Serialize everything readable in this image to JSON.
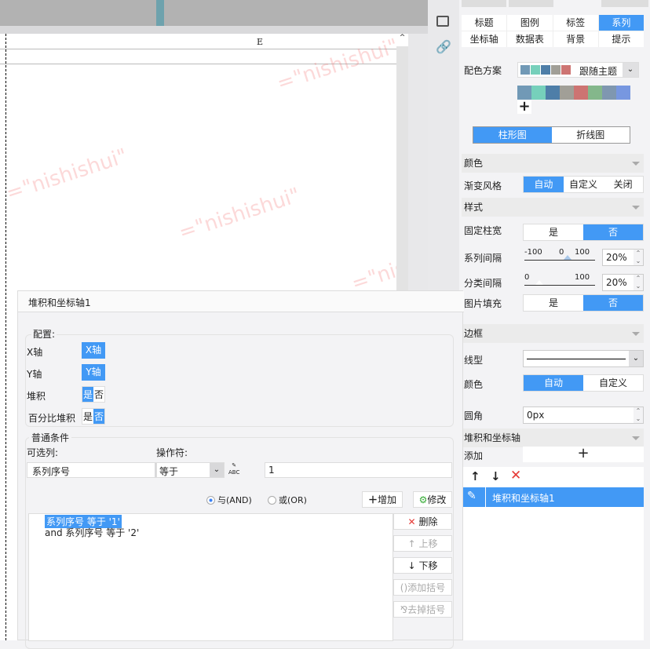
{
  "canvas": {
    "column_header": "E",
    "watermark": "=\"nishishui\""
  },
  "right_panel": {
    "tabs_row1": [
      "标题",
      "图例",
      "标签",
      "系列"
    ],
    "tabs_row2": [
      "坐标轴",
      "数据表",
      "背景",
      "提示"
    ],
    "active_tab": "系列",
    "color_scheme": {
      "label": "配色方案",
      "value": "跟随主题",
      "swatches_preview": [
        "#7199b6",
        "#76d0bb",
        "#4e7ea8",
        "#a19f97",
        "#cd7472"
      ],
      "palette": [
        "#7199b6",
        "#76d0bb",
        "#4e7ea8",
        "#a19f97",
        "#cd7472",
        "#84b78b",
        "#7f97b0",
        "#7797e0"
      ],
      "add": "+"
    },
    "chart_types": [
      "柱形图",
      "折线图"
    ],
    "sections": {
      "color": "颜色",
      "style": "样式",
      "border": "边框",
      "stack_axis": "堆积和坐标轴"
    },
    "gradient": {
      "label": "渐变风格",
      "options": [
        "自动",
        "自定义",
        "关闭"
      ]
    },
    "fixed_width": {
      "label": "固定柱宽",
      "options": [
        "是",
        "否"
      ]
    },
    "series_gap": {
      "label": "系列间隔",
      "ticks": [
        "-100",
        "0",
        "100"
      ],
      "value": "20%"
    },
    "category_gap": {
      "label": "分类间隔",
      "ticks": [
        "0",
        "100"
      ],
      "value": "20%"
    },
    "image_fill": {
      "label": "图片填充",
      "options": [
        "是",
        "否"
      ]
    },
    "line_type": {
      "label": "线型"
    },
    "border_color": {
      "label": "颜色",
      "options": [
        "自动",
        "自定义"
      ]
    },
    "radius": {
      "label": "圆角",
      "value": "0px"
    },
    "add": {
      "label": "添加",
      "button": "+"
    },
    "list_item": "堆积和坐标轴1"
  },
  "dialog": {
    "title": "堆积和坐标轴1",
    "config": {
      "legend": "配置:",
      "x_axis": {
        "label": "X轴",
        "value": "X轴"
      },
      "y_axis": {
        "label": "Y轴",
        "value": "Y轴"
      },
      "stack": {
        "label": "堆积",
        "options": [
          "是",
          "否"
        ]
      },
      "percent_stack": {
        "label": "百分比堆积",
        "options": [
          "是",
          "否"
        ]
      }
    },
    "conditions": {
      "legend": "普通条件",
      "column_label": "可选列:",
      "column_value": "系列序号",
      "operator_label": "操作符:",
      "operator_value": "等于",
      "value": "1",
      "and_label": "与(AND)",
      "or_label": "或(OR)",
      "add": "增加",
      "modify": "修改",
      "items": [
        "系列序号 等于 '1'",
        "and 系列序号 等于 '2'"
      ],
      "side_buttons": [
        "删除",
        "上移",
        "下移",
        "添加括号",
        "去掉括号"
      ]
    }
  }
}
